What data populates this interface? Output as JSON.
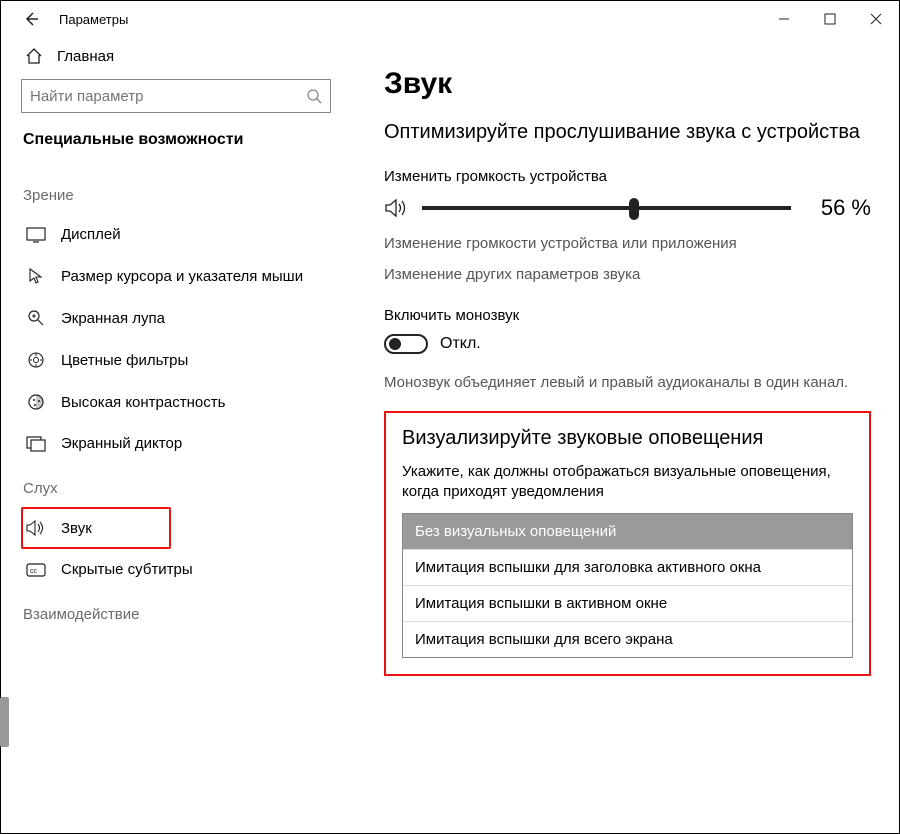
{
  "window": {
    "title": "Параметры"
  },
  "sidebar": {
    "home": "Главная",
    "search_placeholder": "Найти параметр",
    "section_title": "Специальные возможности",
    "groups": [
      {
        "label": "Зрение",
        "items": [
          {
            "icon": "display-icon",
            "label": "Дисплей"
          },
          {
            "icon": "cursor-icon",
            "label": "Размер курсора и указателя мыши"
          },
          {
            "icon": "magnifier-icon",
            "label": "Экранная лупа"
          },
          {
            "icon": "colorfilter-icon",
            "label": "Цветные фильтры"
          },
          {
            "icon": "contrast-icon",
            "label": "Высокая контрастность"
          },
          {
            "icon": "narrator-icon",
            "label": "Экранный диктор"
          }
        ]
      },
      {
        "label": "Слух",
        "items": [
          {
            "icon": "sound-icon",
            "label": "Звук",
            "highlighted": true
          },
          {
            "icon": "cc-icon",
            "label": "Скрытые субтитры"
          }
        ]
      },
      {
        "label": "Взаимодействие",
        "items": []
      }
    ]
  },
  "main": {
    "heading": "Звук",
    "lead": "Оптимизируйте прослушивание звука с устройства",
    "volume_label": "Изменить громкость устройства",
    "volume_percent": 56,
    "volume_display": "56 %",
    "link1": "Изменение громкости устройства или приложения",
    "link2": "Изменение других параметров звука",
    "mono_label": "Включить монозвук",
    "toggle_state": "Откл.",
    "mono_desc": "Монозвук объединяет левый и правый аудиоканалы в один канал.",
    "visual_heading": "Визуализируйте звуковые оповещения",
    "visual_desc": "Укажите, как должны отображаться визуальные оповещения, когда приходят уведомления",
    "options": [
      "Без визуальных оповещений",
      "Имитация вспышки для заголовка активного окна",
      "Имитация вспышки в активном окне",
      "Имитация вспышки для всего экрана"
    ]
  }
}
